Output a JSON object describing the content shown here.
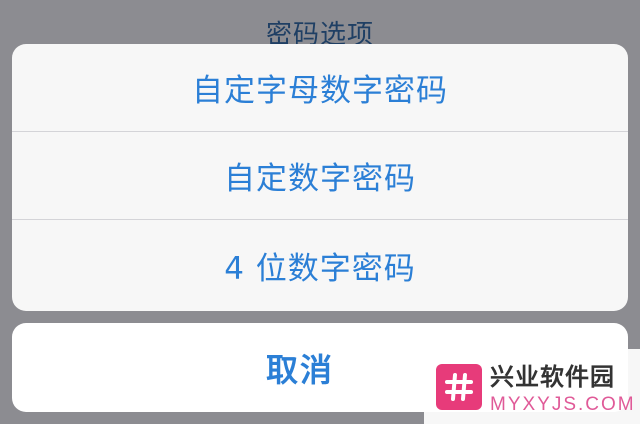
{
  "sheet": {
    "title": "密码选项",
    "options": [
      {
        "label": "自定字母数字密码"
      },
      {
        "label": "自定数字密码"
      },
      {
        "label": "4 位数字密码"
      }
    ],
    "cancel_label": "取消"
  },
  "watermark": {
    "brand_cn": "兴业软件园",
    "brand_en": "MYXYJS.COM",
    "logo_icon": "hash-icon"
  },
  "colors": {
    "backdrop": "#8c8c91",
    "accent": "#2b7fd6",
    "watermark_pink": "#e73b7a"
  }
}
